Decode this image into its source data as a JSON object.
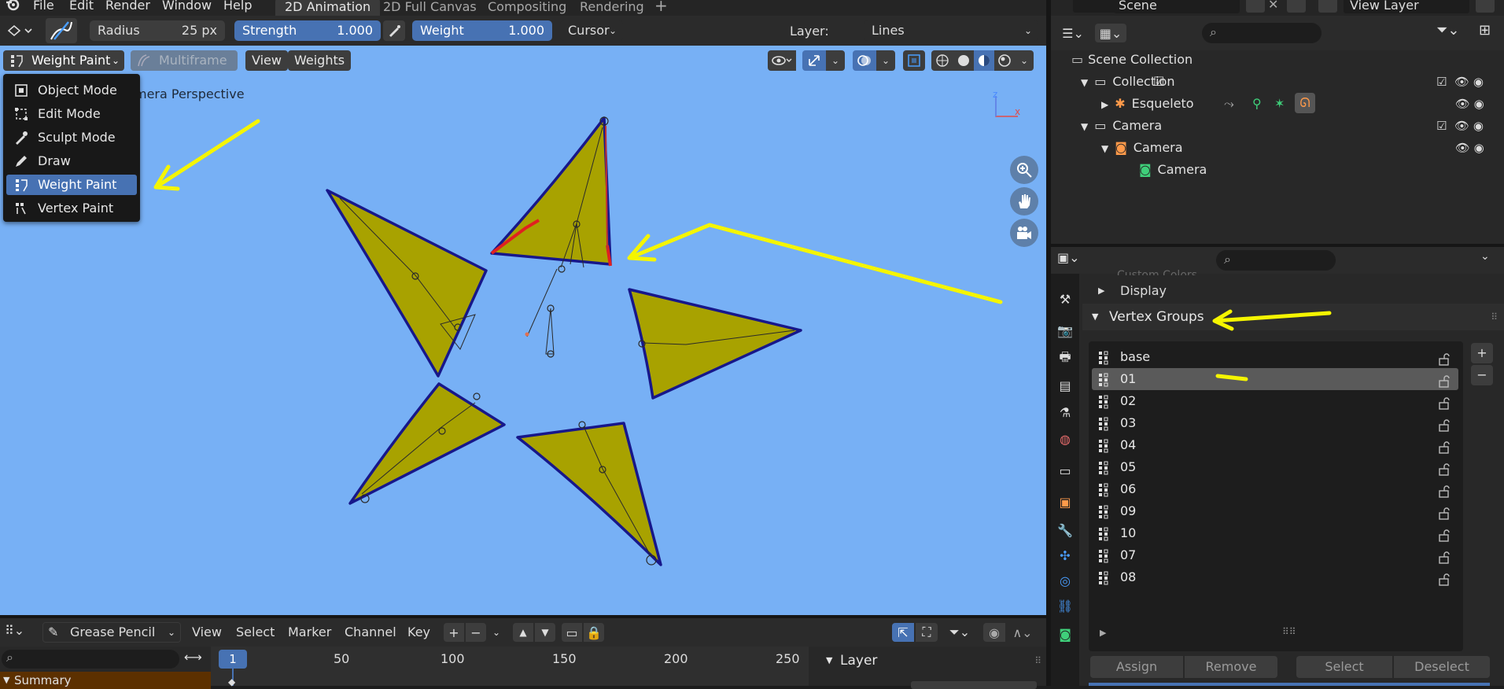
{
  "menu": {
    "file": "File",
    "edit": "Edit",
    "render": "Render",
    "window": "Window",
    "help": "Help"
  },
  "workspaces": [
    "2D Animation",
    "2D Full Canvas",
    "Compositing",
    "Rendering"
  ],
  "active_workspace": "2D Animation",
  "scene": {
    "label": "Scene",
    "view_layer": "View Layer"
  },
  "toolbar": {
    "radius_label": "Radius",
    "radius_value": "25 px",
    "strength_label": "Strength",
    "strength_value": "1.000",
    "weight_label": "Weight",
    "weight_value": "1.000",
    "falloff": "Cursor",
    "layer_label": "Layer:",
    "layer_value": "Lines"
  },
  "viewport_header": {
    "mode": "Weight Paint",
    "multiframe": "Multiframe",
    "view": "View",
    "weights": "Weights"
  },
  "viewport_overlay_text": "Camera Perspective",
  "mode_menu": {
    "items": [
      "Object Mode",
      "Edit Mode",
      "Sculpt Mode",
      "Draw",
      "Weight Paint",
      "Vertex Paint"
    ],
    "selected": "Weight Paint"
  },
  "outliner": {
    "scene_collection": "Scene Collection",
    "collection": "Collection",
    "esqueleto": "Esqueleto",
    "camera_collection": "Camera",
    "camera_object": "Camera",
    "camera_data": "Camera"
  },
  "properties": {
    "custom_colors": "Custom Colors",
    "display": "Display",
    "vertex_groups_title": "Vertex Groups",
    "vertex_groups": [
      "base",
      "01",
      "02",
      "03",
      "04",
      "05",
      "06",
      "09",
      "10",
      "07",
      "08"
    ],
    "selected_group": "01",
    "buttons": {
      "assign": "Assign",
      "remove": "Remove",
      "select": "Select",
      "deselect": "Deselect"
    }
  },
  "timeline": {
    "editor": "Grease Pencil",
    "menus": [
      "View",
      "Select",
      "Marker",
      "Channel",
      "Key"
    ],
    "current_frame": "1",
    "frames": [
      "50",
      "100",
      "150",
      "200",
      "250"
    ],
    "summary": "Summary",
    "layer_panel": "Layer"
  },
  "colors": {
    "viewport_bg": "#77b0f5",
    "star_fill": "#a8a200",
    "star_outline": "#17178a",
    "annotation": "#f5f500",
    "accent": "#4772b3"
  }
}
